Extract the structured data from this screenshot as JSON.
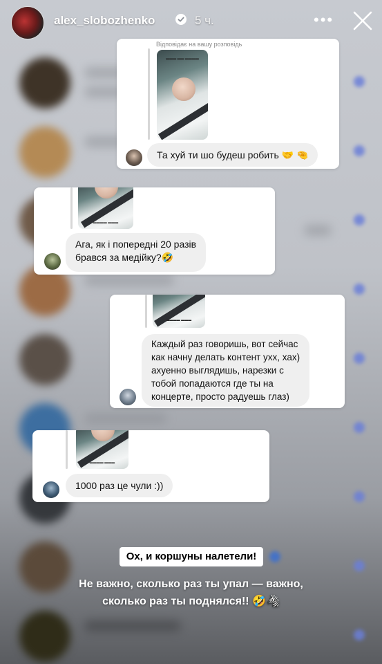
{
  "story": {
    "username": "alex_slobozhenko",
    "time_ago": "5 ч.",
    "more_label": "•••",
    "close_icon": "close-icon",
    "verified_icon": "verified-badge-icon"
  },
  "cards": [
    {
      "reply_label": "Відповідає на вашу розповідь",
      "message": "Та хуй ти шо будеш робить 🤝 🤏"
    },
    {
      "message_lines": [
        "Ага, як і попередні 20 разів",
        "брався за медійку?🤣"
      ]
    },
    {
      "message_lines": [
        "Каждый раз говоришь, вот сейчас",
        "как начну делать контент ухх, хах)",
        "ахуенно выглядишь, нарезки с",
        "тобой попадаются где ты на",
        "концерте, просто радуешь глаз)"
      ]
    },
    {
      "message": "1000 раз це чули :))"
    }
  ],
  "overlay": {
    "tag": "Ох, и коршуны налетели!",
    "caption_line1": "Не важно, сколько раз ты упал — важно,",
    "caption_line2": "сколько раз ты поднялся!! 🤣🦓"
  },
  "colors": {
    "accent_unread": "#6b7fd8",
    "bubble": "#efefef",
    "card": "#ffffff"
  }
}
